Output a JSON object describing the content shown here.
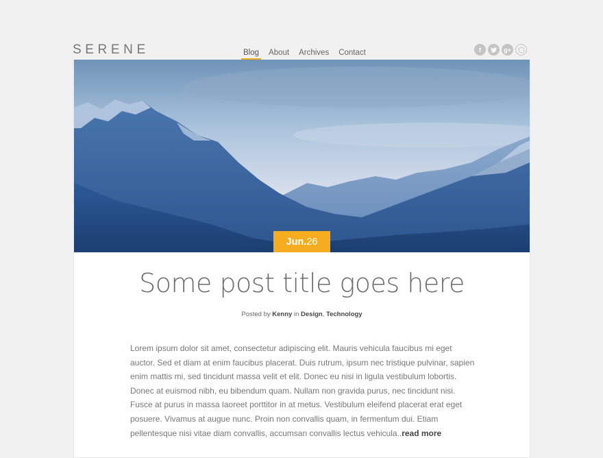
{
  "site": {
    "logo": "SERENE"
  },
  "nav": {
    "items": [
      {
        "label": "Blog",
        "active": true
      },
      {
        "label": "About",
        "active": false
      },
      {
        "label": "Archives",
        "active": false
      },
      {
        "label": "Contact",
        "active": false
      }
    ]
  },
  "social": {
    "icons": [
      {
        "name": "facebook-icon",
        "glyph": "f"
      },
      {
        "name": "twitter-icon",
        "glyph": "t"
      },
      {
        "name": "google-plus-icon",
        "glyph": "g+"
      },
      {
        "name": "rss-icon",
        "glyph": ""
      }
    ]
  },
  "post": {
    "date_month": "Jun.",
    "date_day": "26",
    "title": "Some post title goes here",
    "meta_posted_by": "Posted by",
    "meta_author": "Kenny",
    "meta_in": "in",
    "meta_cat1": "Design",
    "meta_sep": ",",
    "meta_cat2": "Technology",
    "excerpt": "Lorem ipsum dolor sit amet, consectetur adipiscing elit. Mauris vehicula faucibus mi eget auctor. Sed et diam at enim faucibus placerat. Duis rutrum, ipsum nec tristique pulvinar, sapien enim mattis mi, sed tincidunt massa velit et elit. Donec eu nisi in ligula vestibulum lob­ortis. Donec at euismod nibh, eu bibendum quam. Nullam non gravida purus, nec tincidunt nisi. Fusce at purus in massa laoreet porttitor in at metus. Vestibulum eleifend placerat erat eget posuere. Vivamus at augue nunc. Proin non convallis quam, in fermentum dui. Etiam pellentesque nisi vitae diam convallis, accumsan convallis lectus vehicula..",
    "read_more": "read more"
  },
  "colors": {
    "accent": "#f5ac1e",
    "background": "#f1f1f1"
  }
}
